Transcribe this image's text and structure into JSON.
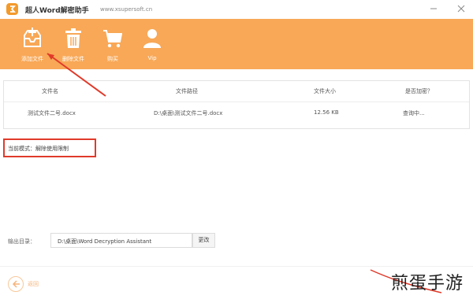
{
  "window": {
    "title": "超人Word解密助手",
    "url": "www.xsupersoft.cn",
    "min_icon": "minimize-icon",
    "close_icon": "close-icon"
  },
  "toolbar": {
    "items": [
      {
        "label": "添加文件",
        "icon": "add-file-icon"
      },
      {
        "label": "删除文件",
        "icon": "delete-icon"
      },
      {
        "label": "购买",
        "icon": "cart-icon"
      },
      {
        "label": "Vip",
        "icon": "user-icon"
      }
    ],
    "background": "#f8a857"
  },
  "table": {
    "columns": [
      "文件名",
      "文件路径",
      "文件大小",
      "是否加密？"
    ],
    "rows": [
      [
        "测试文件二号.docx",
        "D:\\桌面\\测试文件二号.docx",
        "12.56 KB",
        "查询中..."
      ]
    ]
  },
  "mode": {
    "text": "当前模式：解除使用限制"
  },
  "output": {
    "label": "输出目录：",
    "path": "D:\\桌面\\Word Decryption Assistant",
    "change_label": "更改"
  },
  "footer": {
    "back_label": "返回",
    "back_icon": "back-arrow-icon"
  },
  "watermark": {
    "text": "煎蛋手游"
  },
  "colors": {
    "accent": "#f8a857",
    "annotation": "#e03a2a"
  }
}
